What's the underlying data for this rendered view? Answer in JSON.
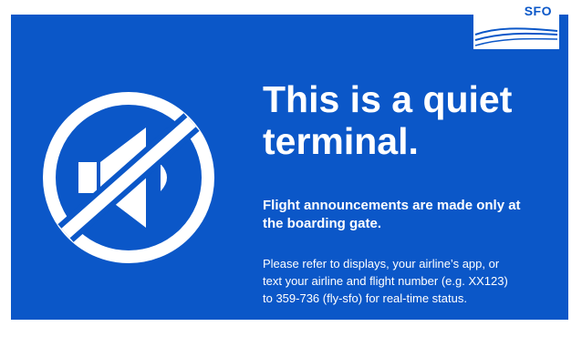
{
  "logo": {
    "text": "SFO",
    "icon": "sfo-wave-logo"
  },
  "icon": {
    "name": "no-sound-icon"
  },
  "sign": {
    "title": "This is a quiet\nterminal.",
    "subtitle": "Flight announcements are made only at\nthe boarding gate.",
    "body": "Please refer to displays, your airline’s app, or\ntext your airline and flight number (e.g. XX123)\nto 359-736 (fly-sfo) for real-time status."
  },
  "colors": {
    "background": "#0b57c8",
    "foreground": "#ffffff"
  }
}
